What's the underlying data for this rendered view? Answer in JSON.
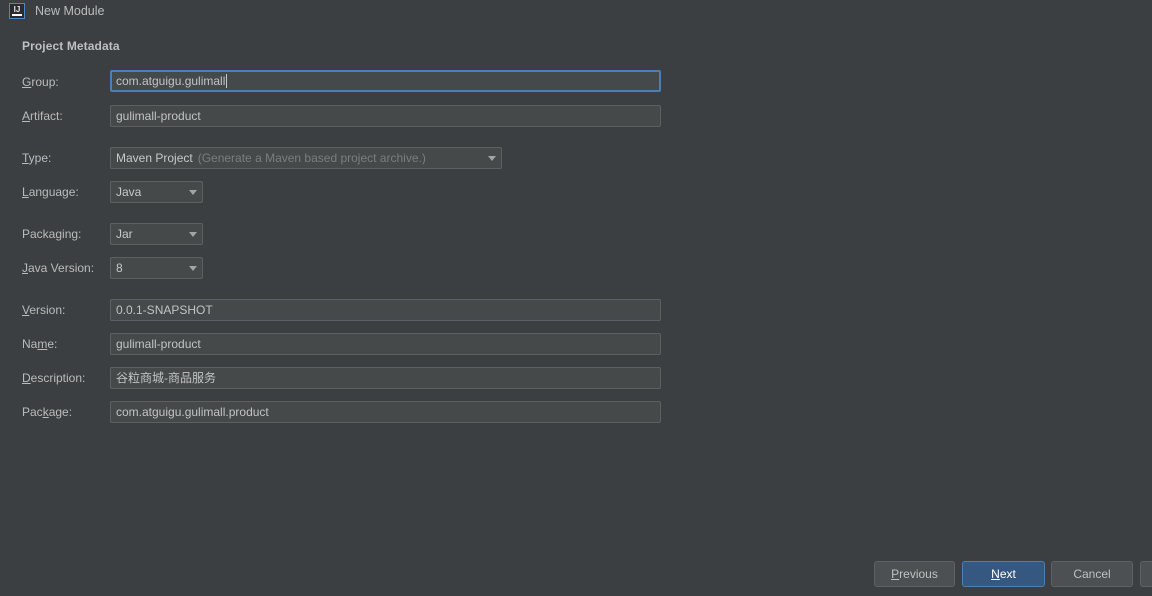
{
  "window": {
    "title": "New Module",
    "icon": "intellij-idea-icon",
    "icon_text": "IJ"
  },
  "section": {
    "heading": "Project Metadata"
  },
  "colors": {
    "background": "#3c3f41",
    "input_background": "#45494a",
    "input_border": "#5e6060",
    "focus_border": "#4d7fb3",
    "primary_button": "#365880",
    "text": "#bbbbbb",
    "hint_text": "#7b7d7e"
  },
  "fields": {
    "group": {
      "label_pre": "G",
      "label_post": "roup:",
      "value": "com.atguigu.gulimall",
      "focused": true
    },
    "artifact": {
      "label_pre": "A",
      "label_post": "rtifact:",
      "value": "gulimall-product"
    },
    "type": {
      "label_pre": "T",
      "label_post": "ype:",
      "value": "Maven Project",
      "hint": "(Generate a Maven based project archive.)"
    },
    "language": {
      "label_pre": "L",
      "label_post": "anguage:",
      "value": "Java"
    },
    "packaging": {
      "label_a": "Packa",
      "label_pre": "g",
      "label_post": "ing:",
      "value": "Jar"
    },
    "java_version": {
      "label_pre": "J",
      "label_post": "ava Version:",
      "value": "8"
    },
    "version": {
      "label_pre": "V",
      "label_post": "ersion:",
      "value": "0.0.1-SNAPSHOT"
    },
    "name": {
      "label_a": "Na",
      "label_pre": "m",
      "label_post": "e:",
      "value": "gulimall-product"
    },
    "description": {
      "label_pre": "D",
      "label_post": "escription:",
      "value": "谷粒商城-商品服务"
    },
    "package": {
      "label_a": "Pac",
      "label_pre": "k",
      "label_post": "age:",
      "value": "com.atguigu.gulimall.product"
    }
  },
  "buttons": {
    "previous": {
      "label_pre": "P",
      "label_post": "revious"
    },
    "next": {
      "label_pre": "N",
      "label_post": "ext",
      "primary": true
    },
    "cancel": {
      "label": "Cancel"
    }
  }
}
